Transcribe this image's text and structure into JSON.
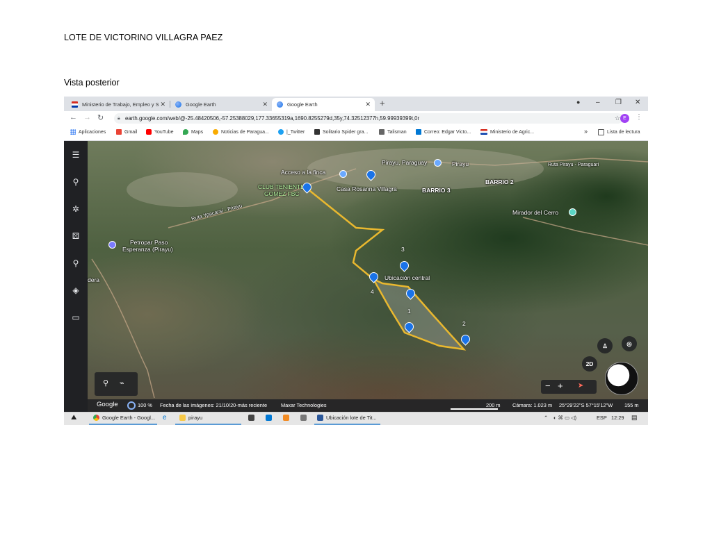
{
  "document": {
    "title": "LOTE DE VICTORINO VILLAGRA PAEZ",
    "subtitle": "Vista posterior"
  },
  "browser": {
    "tabs": [
      {
        "label": "Ministerio de Trabajo, Empleo y S",
        "icon": "paraguay-flag-icon"
      },
      {
        "label": "Google Earth",
        "icon": "google-earth-icon"
      },
      {
        "label": "Google Earth",
        "icon": "google-earth-icon",
        "active": true
      }
    ],
    "new_tab": "+",
    "url": "earth.google.com/web/@-25.48420506,-57.25388029,177.33655319a,1690.8255279d,35y,74.32512377h,59.99939399t,0r",
    "profile_initial": "E",
    "bookmarks": [
      {
        "label": "Aplicaciones",
        "icon": "apps-grid-icon",
        "color": "#4285f4"
      },
      {
        "label": "Gmail",
        "icon": "gmail-icon",
        "color": "#ea4335"
      },
      {
        "label": "YouTube",
        "icon": "youtube-icon",
        "color": "#ff0000"
      },
      {
        "label": "Maps",
        "icon": "maps-icon",
        "color": "#34a853"
      },
      {
        "label": "Noticias de Paragua...",
        "icon": "news-icon",
        "color": "#f9ab00"
      },
      {
        "label": "|_Twitter",
        "icon": "twitter-icon",
        "color": "#1da1f2"
      },
      {
        "label": "Solitario Spider gra...",
        "icon": "solitaire-icon",
        "color": "#333333"
      },
      {
        "label": "Talisman",
        "icon": "talisman-icon",
        "color": "#666666"
      },
      {
        "label": "Correo: Edgar Victo...",
        "icon": "outlook-icon",
        "color": "#0078d4"
      },
      {
        "label": "Ministerio de Agric...",
        "icon": "paraguay-flag-icon",
        "color": "#d52b1e"
      }
    ],
    "bookmarks_overflow": "»",
    "reading_list": "Lista de lectura"
  },
  "map": {
    "labels": [
      {
        "text": "Acceso a la finca",
        "style": "white"
      },
      {
        "text": "Pirayu, Paraguay",
        "style": "white"
      },
      {
        "text": "Pirayu",
        "style": "white"
      },
      {
        "text": "Ruta Pirayu - Paraguari",
        "style": "white"
      },
      {
        "text": "CLUB TENIENTE",
        "style": "green"
      },
      {
        "text": "GOMEZ FBC",
        "style": "green"
      },
      {
        "text": "Casa Rosanna Villagra",
        "style": "white"
      },
      {
        "text": "BARRIO 3",
        "style": "bold"
      },
      {
        "text": "BARRIO 2",
        "style": "bold"
      },
      {
        "text": "Mirador del Cerro",
        "style": "white"
      },
      {
        "text": "Ruta Ypacaraí - Pirayu",
        "style": "white"
      },
      {
        "text": "Petropar Paso",
        "style": "white"
      },
      {
        "text": "Esperanza (Pirayu)",
        "style": "white"
      },
      {
        "text": "dera",
        "style": "white"
      },
      {
        "text": "Ubicación central",
        "style": "white"
      }
    ],
    "point_numbers": [
      "1",
      "2",
      "3",
      "4"
    ],
    "mode_button": "2D",
    "zoom_minus": "−",
    "zoom_plus": "+",
    "path_color": "#e9b82f",
    "pin_color": "#1a73e8"
  },
  "status_bar": {
    "brand": "Google",
    "load": "100 %",
    "imagery_date": "Fecha de las imágenes: 21/10/20-más reciente",
    "provider": "Maxar Technologies",
    "scale": "200 m",
    "camera": "Cámara: 1.023 m",
    "coords": "25°29'22\"S 57°15'12\"W",
    "elevation": "155 m"
  },
  "taskbar": {
    "items": [
      {
        "label": "Google Earth - Googl...",
        "icon": "chrome-icon"
      },
      {
        "label": "pirayu",
        "icon": "folder-icon"
      },
      {
        "label": "Ubicación lote de Tit...",
        "icon": "word-icon"
      }
    ],
    "language": "ESP",
    "time": "12:29"
  }
}
